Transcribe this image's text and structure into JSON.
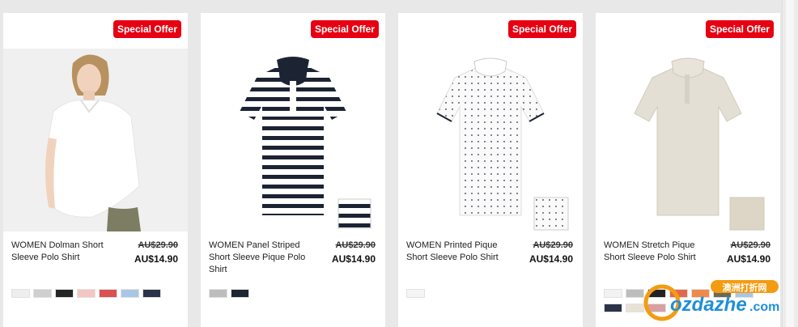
{
  "products": [
    {
      "badge": "Special Offer",
      "name": "WOMEN Dolman Short Sleeve Polo Shirt",
      "old_price": "AU$29.90",
      "price": "AU$14.90",
      "swatches": [
        "#eeeeee",
        "#cfcfcf",
        "#252525",
        "#f2c6c3",
        "#db5050",
        "#a8c7e6",
        "#2c3348"
      ]
    },
    {
      "badge": "Special Offer",
      "name": "WOMEN Panel Striped Short Sleeve Pique Polo Shirt",
      "old_price": "AU$29.90",
      "price": "AU$14.90",
      "swatches": [
        "#bdbdbd",
        "#1e2633"
      ]
    },
    {
      "badge": "Special Offer",
      "name": "WOMEN Printed Pique Short Sleeve Polo Shirt",
      "old_price": "AU$29.90",
      "price": "AU$14.90",
      "swatches": [
        "#f5f5f5"
      ]
    },
    {
      "badge": "Special Offer",
      "name": "WOMEN Stretch Pique Short Sleeve Polo Shirt",
      "old_price": "AU$29.90",
      "price": "AU$14.90",
      "swatches": [
        "#f2f2f2",
        "#bdbdbd",
        "#222222",
        "#e06a4a",
        "#f08a4a",
        "#6b6b55",
        "#a8c7e6",
        "#2c3348",
        "#e8e2d6",
        "#d9a0a0"
      ]
    }
  ],
  "watermark": {
    "text": "ozdazhe",
    "suffix": ".com",
    "chinese": "澳洲打折网"
  },
  "colors": {
    "badge": "#e60012",
    "background": "#e8e8e8"
  }
}
